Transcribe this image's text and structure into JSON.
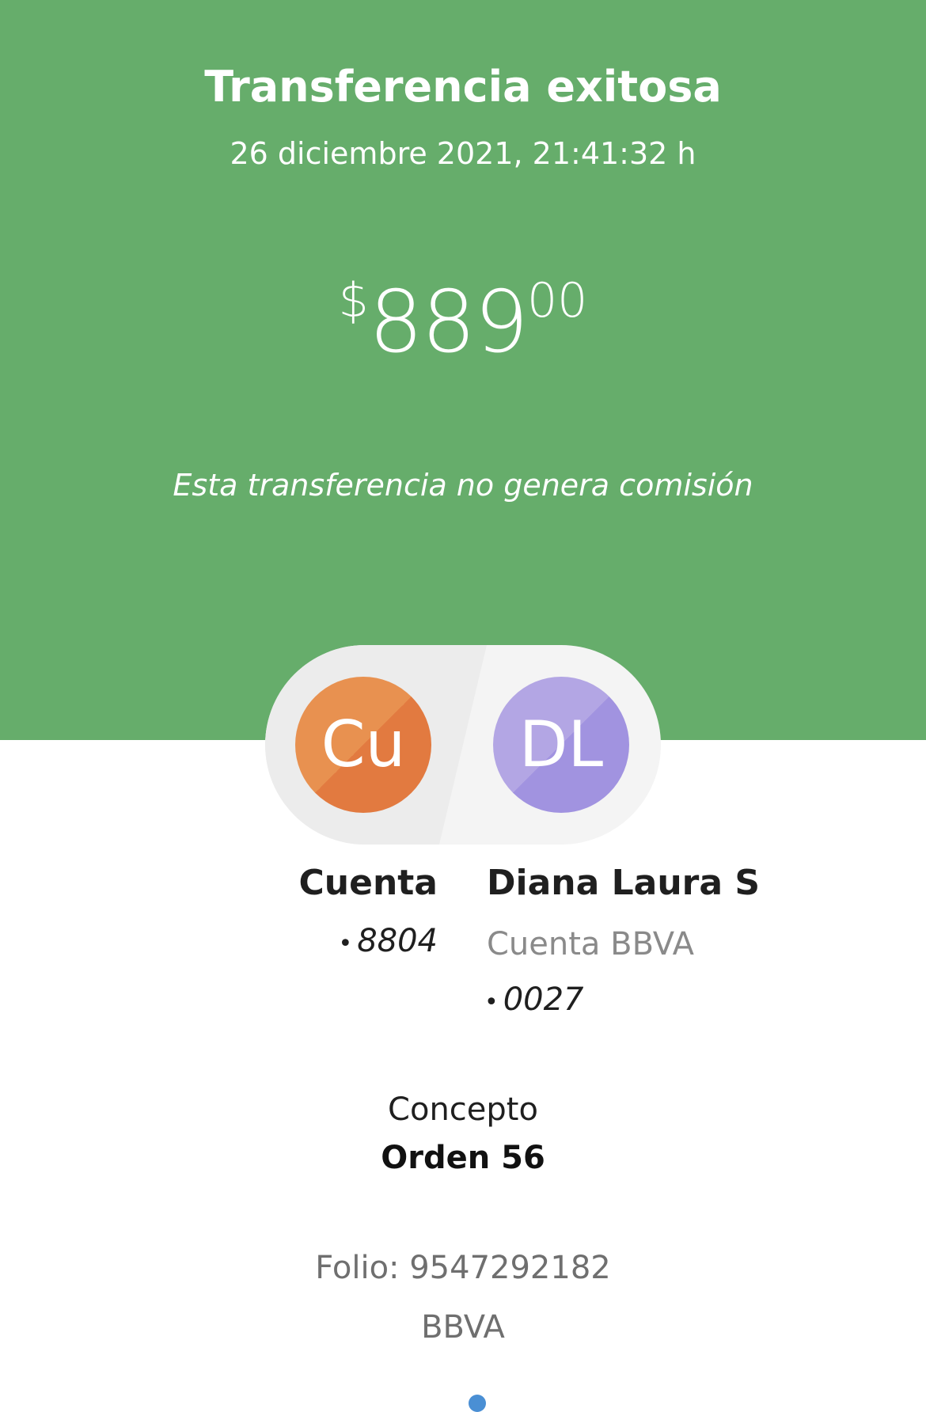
{
  "header": {
    "title": "Transferencia exitosa",
    "datetime": "26 diciembre 2021, 21:41:32 h",
    "amount": {
      "currency": "$",
      "integer": "889",
      "decimals": "00"
    },
    "fee_note": "Esta transferencia no genera comisión"
  },
  "source": {
    "initials": "Cu",
    "name": "Cuenta",
    "account_bullet": "•",
    "account_suffix": "8804"
  },
  "destination": {
    "initials": "DL",
    "name": "Diana Laura S",
    "bank_account_label": "Cuenta BBVA",
    "account_bullet": "•",
    "account_suffix": "0027"
  },
  "concept": {
    "label": "Concepto",
    "value": "Orden 56"
  },
  "footer": {
    "folio": "Folio: 9547292182",
    "bank": "BBVA"
  },
  "colors": {
    "hero_background": "#66ad6b",
    "source_avatar": "#e5874a",
    "destination_avatar": "#aa9de2",
    "page_indicator": "#4a8fd4"
  }
}
